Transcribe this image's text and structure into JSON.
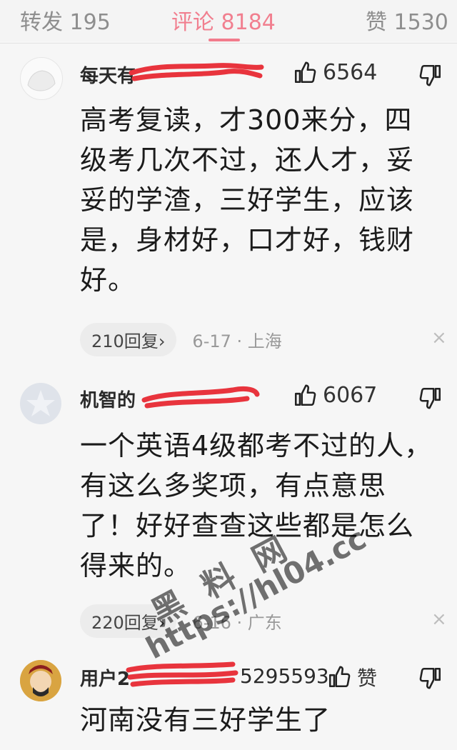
{
  "tabs": {
    "repost": "转发 195",
    "comments": "评论 8184",
    "likes": "赞 1530"
  },
  "comments": [
    {
      "username": "每天有",
      "likes": "6564",
      "text": "高考复读，才300来分，四级考几次不过，还人才，妥妥的学渣，三好学生，应该是，身材好，口才好，钱财好。",
      "replies": "210回复",
      "reply_arrow": "›",
      "meta": "6-17 · 上海",
      "close": "×"
    },
    {
      "username": "机智的",
      "likes": "6067",
      "text": "一个英语4级都考不过的人，有这么多奖项，有点意思了！好好查查这些都是怎么得来的。",
      "replies": "220回复",
      "reply_arrow": "›",
      "meta": "6-16 · 广东",
      "close": "×"
    },
    {
      "username": "用户2",
      "username_tail": "5295593",
      "likes": "赞",
      "text": "河南没有三好学生了"
    }
  ],
  "watermark": {
    "line1": "黑料网",
    "line2": "https://hl04.cc"
  },
  "icons": [
    "thumbs-up-icon",
    "thumbs-down-icon",
    "close-icon"
  ],
  "colors": {
    "active_tab": "#f17f8f",
    "scribble": "#e8343d"
  }
}
